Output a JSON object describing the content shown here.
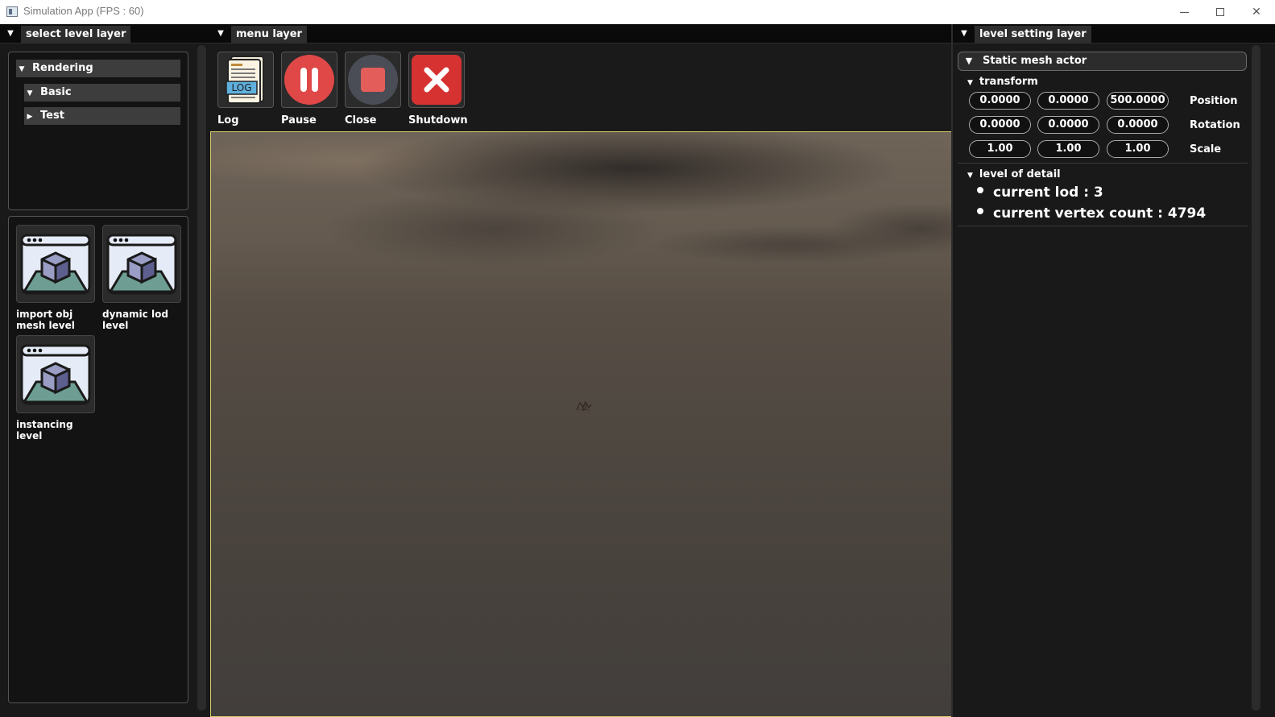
{
  "window": {
    "title": "Simulation App (FPS : 60)",
    "minimize_icon": "minimize-icon",
    "maximize_icon": "maximize-icon",
    "close_glyph": "✕"
  },
  "left_panel": {
    "tab": "select level layer",
    "tree": [
      {
        "label": "Rendering",
        "expanded": true
      },
      {
        "label": "Basic",
        "expanded": true
      },
      {
        "label": "Test",
        "expanded": false
      }
    ],
    "levels": [
      {
        "label": "import obj mesh level",
        "icon": "level-window-cube-icon"
      },
      {
        "label": "dynamic lod level",
        "icon": "level-window-cube-icon"
      },
      {
        "label": "instancing level",
        "icon": "level-window-cube-icon"
      }
    ]
  },
  "center_panel": {
    "tab": "menu layer",
    "tools": [
      {
        "label": "Log",
        "icon": "log-file-icon",
        "icon_text": "LOG"
      },
      {
        "label": "Pause",
        "icon": "pause-icon"
      },
      {
        "label": "Close",
        "icon": "stop-icon"
      },
      {
        "label": "Shutdown",
        "icon": "shutdown-x-icon"
      }
    ]
  },
  "right_panel": {
    "tab": "level setting layer",
    "actor_header": "Static mesh actor",
    "transform": {
      "label": "transform",
      "rows": [
        {
          "label": "Position",
          "values": [
            "0.0000",
            "0.0000",
            "500.0000"
          ]
        },
        {
          "label": "Rotation",
          "values": [
            "0.0000",
            "0.0000",
            "0.0000"
          ]
        },
        {
          "label": "Scale",
          "values": [
            "1.00",
            "1.00",
            "1.00"
          ]
        }
      ]
    },
    "lod": {
      "label": "level of detail",
      "current_lod": "current lod : 3",
      "vertex_count": "current vertex count : 4794"
    }
  },
  "colors": {
    "pause_red": "#e04848",
    "close_red": "#e35d5a",
    "shutdown_red": "#d63232",
    "viewport_border": "#d6cf6a"
  }
}
